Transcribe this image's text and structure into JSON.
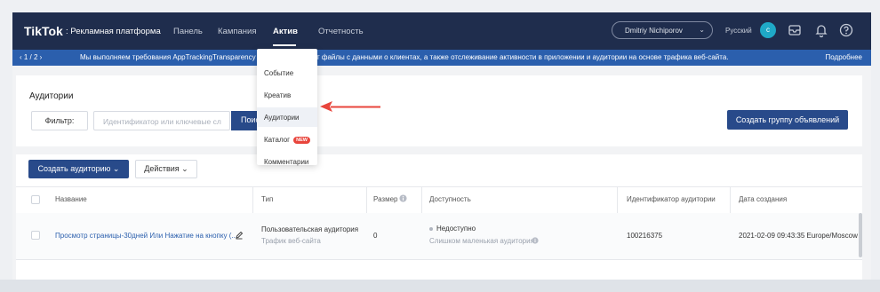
{
  "app": {
    "logo": "TikTok",
    "logo_subtitle": ": Рекламная платформа",
    "nav": [
      "Панель",
      "Кампания",
      "Актив",
      "Отчетность"
    ],
    "user": "Dmitriy Nichiporov",
    "language": "Русский",
    "avatar_letter": "c"
  },
  "banner": {
    "pager": "‹   1 / 2   ›",
    "message_a": "Мы выполняем требования AppTrackingTransparency для",
    "message_b": "т файлы с данными о клиентах, а также отслеживание активности в приложении и аудитории на основе трафика веб-сайта.",
    "more": "Подробнее"
  },
  "audiences": {
    "title": "Аудитории",
    "filter_label": "Фильтр:",
    "filter_placeholder": "Идентификатор или ключевые сл",
    "search_label": "Поиск",
    "create_group_label": "Создать группу объявлений"
  },
  "table": {
    "create_audience_label": "Создать аудиторию ⌄",
    "actions_label": "Действия ⌄",
    "headers": [
      "Название",
      "Тип",
      "Размер",
      "Доступность",
      "Идентификатор аудитории",
      "Дата создания"
    ],
    "rows": [
      {
        "name": "Просмотр страницы-30дней Или Нажатие на кнопку (...",
        "type": "Пользовательская аудитория",
        "type_sub": "Трафик веб-сайта",
        "size": "0",
        "availability": "Недоступно",
        "availability_sub": "Слишком маленькая аудитория.",
        "id": "100216375",
        "created": "2021-02-09 09:43:35 Europe/Moscow"
      }
    ]
  },
  "dropdown": {
    "items": [
      "Событие",
      "Креатив",
      "Аудитории",
      "Каталог",
      "Комментарии"
    ],
    "new_badge": "NEW"
  },
  "colors": {
    "nav_bg": "#1f2d4d",
    "banner_bg": "#2b5fad",
    "primary_button": "#284a8a",
    "arrow": "#e8453c"
  }
}
